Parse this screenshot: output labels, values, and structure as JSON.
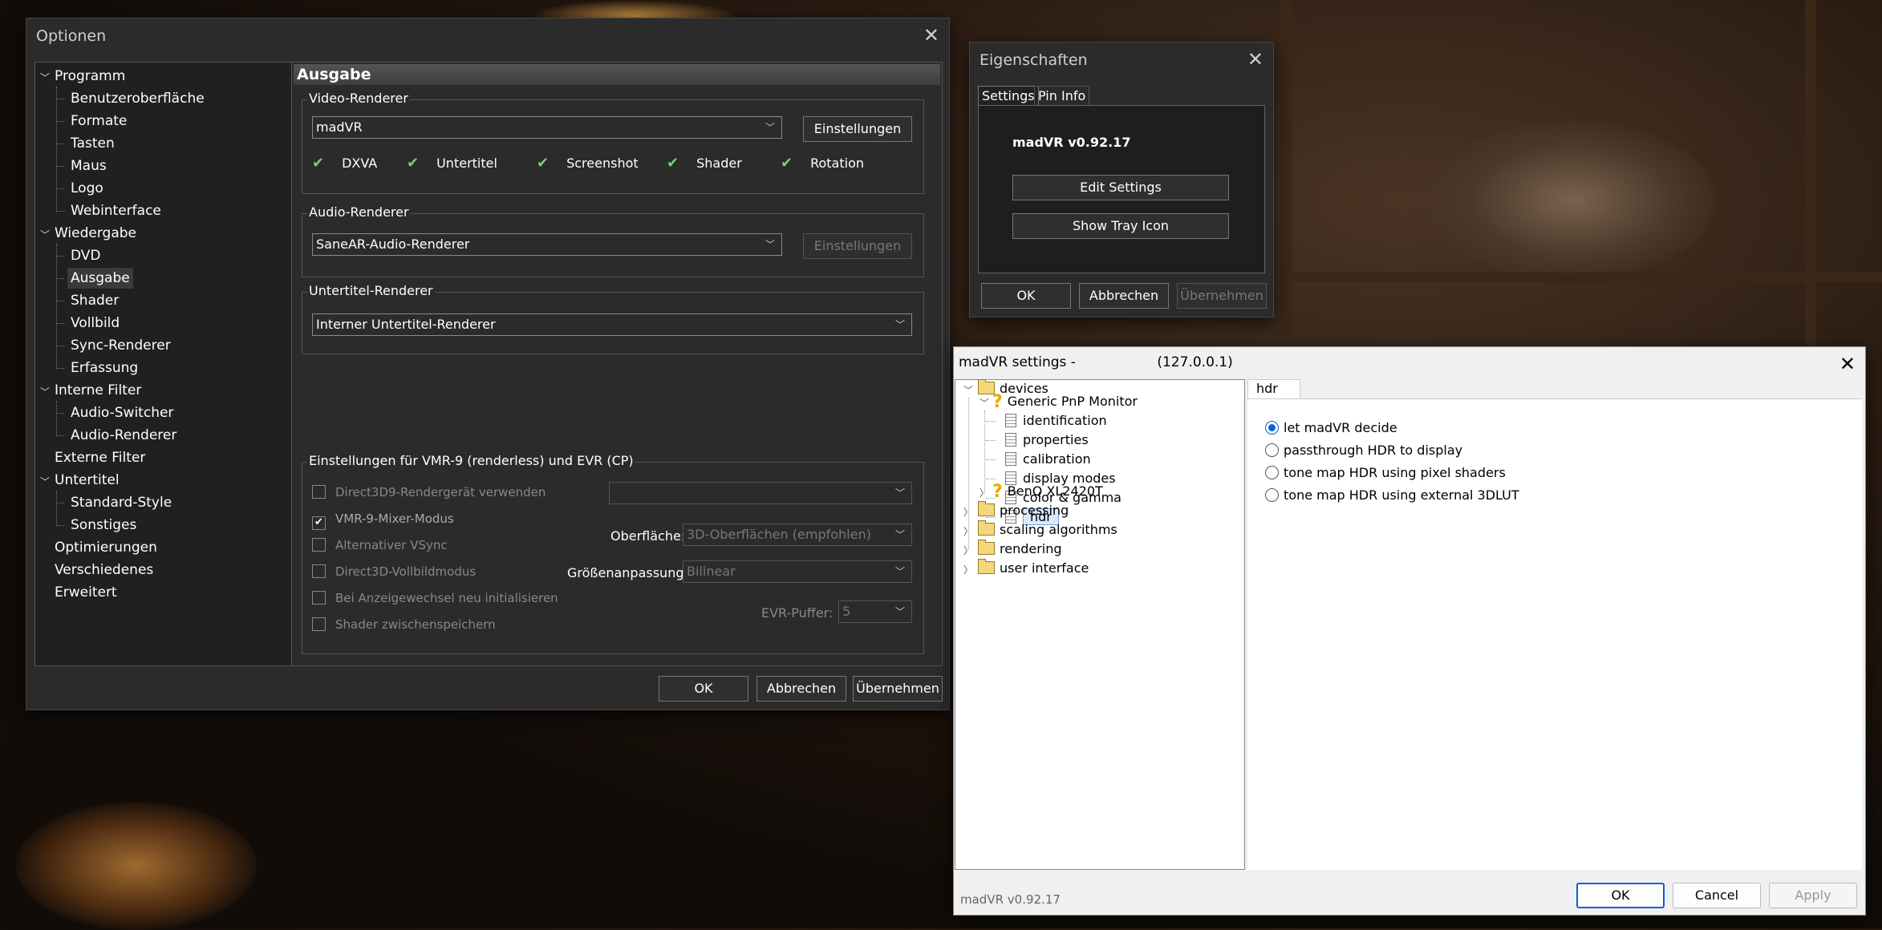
{
  "optionen": {
    "title": "Optionen",
    "tree": [
      {
        "label": "Programm",
        "level": 0,
        "expanded": true
      },
      {
        "label": "Benutzeroberfläche",
        "level": 1
      },
      {
        "label": "Formate",
        "level": 1
      },
      {
        "label": "Tasten",
        "level": 1
      },
      {
        "label": "Maus",
        "level": 1
      },
      {
        "label": "Logo",
        "level": 1
      },
      {
        "label": "Webinterface",
        "level": 1
      },
      {
        "label": "Wiedergabe",
        "level": 0,
        "expanded": true
      },
      {
        "label": "DVD",
        "level": 1
      },
      {
        "label": "Ausgabe",
        "level": 1,
        "selected": true
      },
      {
        "label": "Shader",
        "level": 1
      },
      {
        "label": "Vollbild",
        "level": 1
      },
      {
        "label": "Sync-Renderer",
        "level": 1
      },
      {
        "label": "Erfassung",
        "level": 1
      },
      {
        "label": "Interne Filter",
        "level": 0,
        "expanded": true
      },
      {
        "label": "Audio-Switcher",
        "level": 1
      },
      {
        "label": "Audio-Renderer",
        "level": 1
      },
      {
        "label": "Externe Filter",
        "level": 0
      },
      {
        "label": "Untertitel",
        "level": 0,
        "expanded": true
      },
      {
        "label": "Standard-Style",
        "level": 1
      },
      {
        "label": "Sonstiges",
        "level": 1
      },
      {
        "label": "Optimierungen",
        "level": 0
      },
      {
        "label": "Verschiedenes",
        "level": 0
      },
      {
        "label": "Erweitert",
        "level": 0
      }
    ],
    "panel": {
      "heading": "Ausgabe",
      "video": {
        "label": "Video-Renderer",
        "value": "madVR",
        "button": "Einstellungen",
        "capabilities": [
          "DXVA",
          "Untertitel",
          "Screenshot",
          "Shader",
          "Rotation"
        ]
      },
      "audio": {
        "label": "Audio-Renderer",
        "value": "SaneAR-Audio-Renderer",
        "button": "Einstellungen"
      },
      "subtitle": {
        "label": "Untertitel-Renderer",
        "value": "Interner Untertitel-Renderer"
      },
      "vmr": {
        "label": "Einstellungen für VMR-9 (renderless) und EVR (CP)",
        "checkboxes": [
          {
            "label": "Direct3D9-Rendergerät verwenden",
            "checked": false
          },
          {
            "label": "VMR-9-Mixer-Modus",
            "checked": true
          },
          {
            "label": "Alternativer VSync",
            "checked": false
          },
          {
            "label": "Direct3D-Vollbildmodus",
            "checked": false
          },
          {
            "label": "Bei Anzeigewechsel neu initialisieren",
            "checked": false
          },
          {
            "label": "Shader zwischenspeichern",
            "checked": false
          }
        ],
        "surface_label": "Oberfläche:",
        "surface_value": "3D-Oberflächen (empfohlen)",
        "resize_label": "Größenanpassung:",
        "resize_value": "Bilinear",
        "evr_label": "EVR-Puffer:",
        "evr_value": "5"
      }
    },
    "buttons": {
      "ok": "OK",
      "cancel": "Abbrechen",
      "apply": "Übernehmen"
    }
  },
  "eigenschaften": {
    "title": "Eigenschaften",
    "tabs": [
      "Settings",
      "Pin Info"
    ],
    "version": "madVR v0.92.17",
    "edit_settings": "Edit Settings",
    "show_tray": "Show Tray Icon",
    "buttons": {
      "ok": "OK",
      "cancel": "Abbrechen",
      "apply": "Übernehmen"
    }
  },
  "madvr": {
    "title": "madVR settings -",
    "host": "(127.0.0.1)",
    "tree": {
      "devices": "devices",
      "monitor1": "Generic PnP Monitor",
      "monitor1_items": [
        "identification",
        "properties",
        "calibration",
        "display modes",
        "color & gamma",
        "hdr"
      ],
      "monitor2": "BenQ XL2420T",
      "folders": [
        "processing",
        "scaling algorithms",
        "rendering",
        "user interface"
      ]
    },
    "tab": "hdr",
    "options": [
      {
        "label": "let madVR decide",
        "selected": true
      },
      {
        "label": "passthrough HDR to display",
        "selected": false
      },
      {
        "label": "tone map HDR using pixel shaders",
        "selected": false
      },
      {
        "label": "tone map HDR using external 3DLUT",
        "selected": false
      }
    ],
    "footer_version": "madVR v0.92.17",
    "buttons": {
      "ok": "OK",
      "cancel": "Cancel",
      "apply": "Apply"
    }
  }
}
